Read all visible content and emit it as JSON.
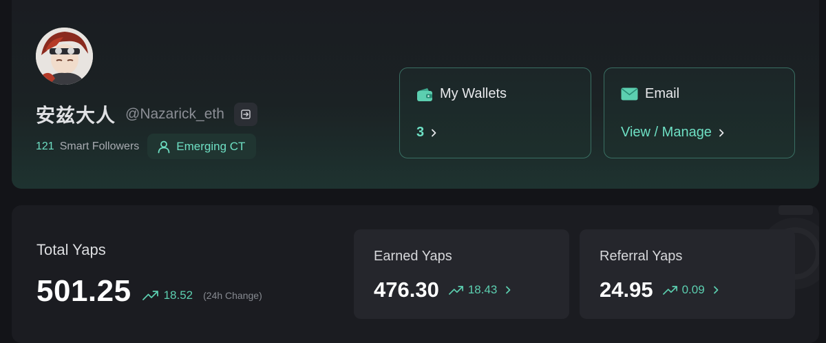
{
  "profile": {
    "display_name": "安兹大人",
    "handle": "@Nazarick_eth",
    "smart_followers_count": "121",
    "smart_followers_label": "Smart Followers",
    "tier_badge": "Emerging CT"
  },
  "wallets_card": {
    "title": "My Wallets",
    "value": "3"
  },
  "email_card": {
    "title": "Email",
    "action": "View / Manage"
  },
  "yaps": {
    "total_label": "Total Yaps",
    "total_value": "501.25",
    "total_change": "18.52",
    "change_note": "(24h Change)",
    "earned": {
      "label": "Earned Yaps",
      "value": "476.30",
      "change": "18.43"
    },
    "referral": {
      "label": "Referral Yaps",
      "value": "24.95",
      "change": "0.09"
    }
  },
  "colors": {
    "accent": "#6ee0c4",
    "background": "#131418",
    "card": "#1b1c21",
    "card_border": "#3a6f63"
  },
  "icons": {
    "logout": "logout-icon",
    "tier": "user-icon",
    "wallet": "wallet-icon",
    "email": "mail-icon",
    "trend": "trending-up-icon",
    "chevron": "chevron-right-icon"
  }
}
